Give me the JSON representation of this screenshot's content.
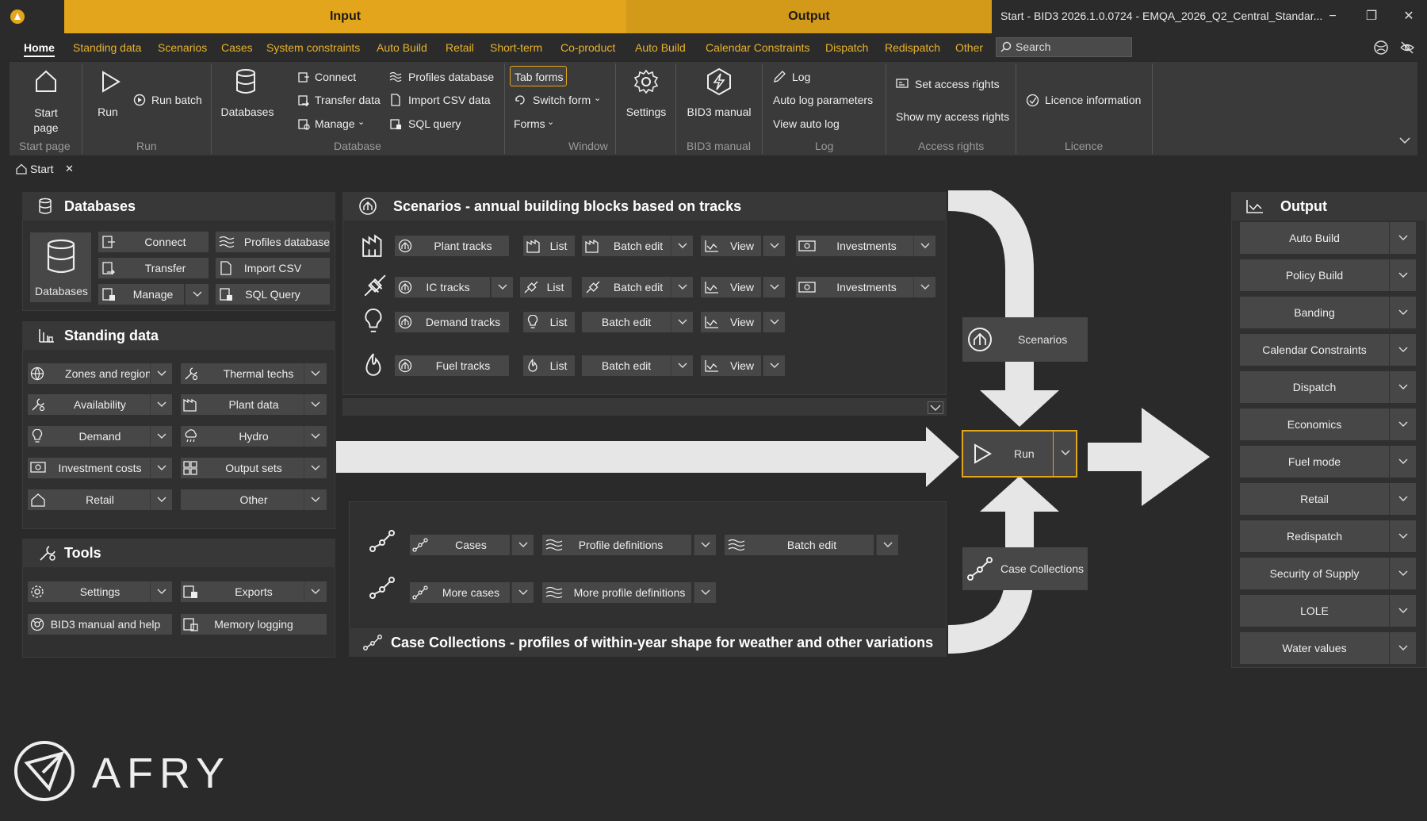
{
  "titlebar": {
    "input_tab": "Input",
    "output_tab": "Output",
    "window_title": "Start - BID3 2026.1.0.0724 - EMQA_2026_Q2_Central_Standar...",
    "minimize": "−",
    "restore": "❐",
    "close": "✕"
  },
  "menu": {
    "items": [
      "Home",
      "Standing data",
      "Scenarios",
      "Cases",
      "System constraints",
      "Auto Build",
      "Retail",
      "Short-term",
      "Co-product",
      "Auto Build",
      "Calendar Constraints",
      "Dispatch",
      "Redispatch",
      "Other"
    ],
    "search_placeholder": "Search"
  },
  "ribbon": {
    "start_page": {
      "label": "Start page",
      "btn": "Start\npage"
    },
    "run": {
      "label": "Run",
      "run": "Run",
      "run_batch": "Run batch"
    },
    "database": {
      "label": "Database",
      "databases": "Databases",
      "connect": "Connect",
      "transfer": "Transfer data",
      "manage": "Manage",
      "profiles": "Profiles database",
      "import_csv": "Import CSV data",
      "sql": "SQL query"
    },
    "window": {
      "label": "Window",
      "tab_forms": "Tab forms",
      "switch_form": "Switch form",
      "forms": "Forms"
    },
    "settings": "Settings",
    "bid3manual": {
      "label": "BID3 manual",
      "btn": "BID3 manual"
    },
    "log": {
      "label": "Log",
      "log": "Log",
      "auto_log_params": "Auto log parameters",
      "view_auto_log": "View auto log"
    },
    "access": {
      "label": "Access rights",
      "set": "Set access rights",
      "show": "Show my access rights"
    },
    "licence": {
      "label": "Licence",
      "info": "Licence information"
    }
  },
  "doc_tab": {
    "label": "Start",
    "close": "✕"
  },
  "databases_panel": {
    "title": "Databases",
    "big": "Databases",
    "connect": "Connect",
    "transfer": "Transfer",
    "manage": "Manage",
    "profiles": "Profiles database",
    "import_csv": "Import CSV",
    "sql": "SQL Query"
  },
  "standing_data": {
    "title": "Standing data",
    "items": [
      "Zones and regions",
      "Thermal techs",
      "Availability",
      "Plant data",
      "Demand",
      "Hydro",
      "Investment costs",
      "Output sets",
      "Retail",
      "Other"
    ]
  },
  "tools": {
    "title": "Tools",
    "settings": "Settings",
    "exports": "Exports",
    "manual": "BID3 manual and help",
    "memory": "Memory logging"
  },
  "scenarios": {
    "title": "Scenarios - annual building blocks based on tracks",
    "rows": [
      {
        "track": "Plant tracks",
        "list": "List",
        "batch": "Batch edit",
        "view": "View",
        "invest": "Investments"
      },
      {
        "track": "IC tracks",
        "list": "List",
        "batch": "Batch edit",
        "view": "View",
        "invest": "Investments"
      },
      {
        "track": "Demand tracks",
        "list": "List",
        "batch": "Batch edit",
        "view": "View"
      },
      {
        "track": "Fuel tracks",
        "list": "List",
        "batch": "Batch edit",
        "view": "View"
      }
    ]
  },
  "cases": {
    "title": "Case Collections - profiles of within-year shape for weather and other variations",
    "cases": "Cases",
    "profile_defs": "Profile definitions",
    "batch": "Batch edit",
    "more_cases": "More cases",
    "more_profile_defs": "More profile definitions"
  },
  "flow": {
    "scenarios": "Scenarios",
    "run": "Run",
    "case_collections": "Case Collections"
  },
  "output": {
    "title": "Output",
    "items": [
      "Auto Build",
      "Policy Build",
      "Banding",
      "Calendar Constraints",
      "Dispatch",
      "Economics",
      "Fuel mode",
      "Retail",
      "Redispatch",
      "Security of Supply",
      "LOLE",
      "Water values"
    ]
  },
  "logo": {
    "text": "AFRY"
  },
  "colors": {
    "accent": "#e3a51c",
    "accent2": "#d39a1a",
    "bg": "#2a2a2a",
    "button": "#474747"
  }
}
